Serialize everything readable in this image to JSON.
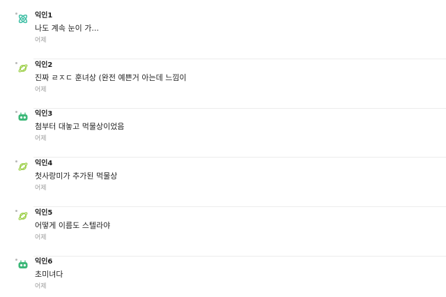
{
  "colors": {
    "atom_icon": "#3fbfa5",
    "planet_icon": "#9ccf48",
    "robot_icon": "#3cb878",
    "time_text": "#9a9a9a",
    "divider": "#ececec"
  },
  "comments": [
    {
      "author": "익인1",
      "body": "나도 계속 눈이 가...",
      "time": "어제",
      "icon": "atom-icon"
    },
    {
      "author": "익인2",
      "body": "진짜 ㄹㅈㄷ 훈녀상 (완전 예쁜거 아는데 느낌이",
      "time": "어제",
      "icon": "planet-icon"
    },
    {
      "author": "익인3",
      "body": "첨부터 대놓고 먹물상이었음",
      "time": "어제",
      "icon": "robot-icon"
    },
    {
      "author": "익인4",
      "body": "첫사랑미가 추가된 먹물상",
      "time": "어제",
      "icon": "planet-icon"
    },
    {
      "author": "익인5",
      "body": "어떻게 이름도 스텔라야",
      "time": "어제",
      "icon": "planet-icon"
    },
    {
      "author": "익인6",
      "body": "초미녀다",
      "time": "어제",
      "icon": "robot-icon"
    }
  ]
}
